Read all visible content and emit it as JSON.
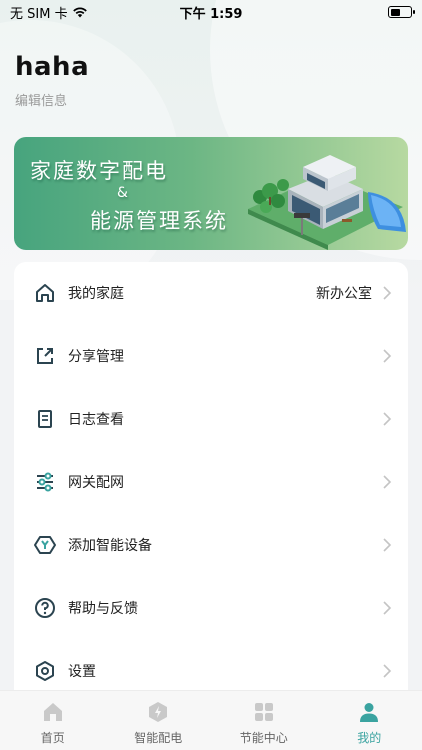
{
  "status_bar": {
    "carrier": "无 SIM 卡",
    "time": "下午 1:59"
  },
  "profile": {
    "username": "haha",
    "edit_label": "编辑信息"
  },
  "banner": {
    "title_line1": "家庭数字配电",
    "ampersand": "&",
    "title_line2": "能源管理系统"
  },
  "menu": {
    "items": [
      {
        "label": "我的家庭",
        "value": "新办公室",
        "icon": "home-icon"
      },
      {
        "label": "分享管理",
        "value": "",
        "icon": "share-icon"
      },
      {
        "label": "日志查看",
        "value": "",
        "icon": "log-icon"
      },
      {
        "label": "网关配网",
        "value": "",
        "icon": "sliders-icon"
      },
      {
        "label": "添加智能设备",
        "value": "",
        "icon": "add-device-icon"
      },
      {
        "label": "帮助与反馈",
        "value": "",
        "icon": "help-icon"
      },
      {
        "label": "设置",
        "value": "",
        "icon": "settings-icon"
      }
    ]
  },
  "tabbar": {
    "tabs": [
      {
        "label": "首页",
        "icon": "home-tab-icon",
        "active": false
      },
      {
        "label": "智能配电",
        "icon": "power-tab-icon",
        "active": false
      },
      {
        "label": "节能中心",
        "icon": "grid-tab-icon",
        "active": false
      },
      {
        "label": "我的",
        "icon": "user-tab-icon",
        "active": true
      }
    ]
  },
  "colors": {
    "accent": "#3aa3a0",
    "icon_dark": "#2b4450",
    "tab_inactive": "#c9c9c9"
  }
}
